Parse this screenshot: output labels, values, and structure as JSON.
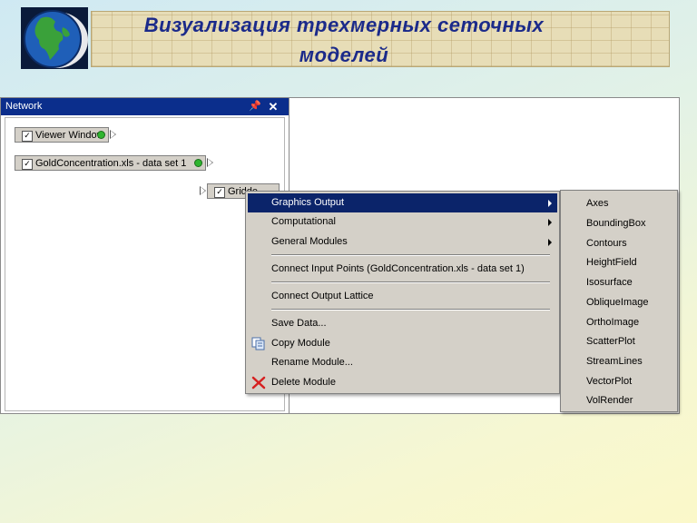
{
  "slide": {
    "title_line1": "Визуализация трехмерных сеточных",
    "title_line2": "моделей"
  },
  "colors": {
    "titlebar": "#0b2e8c",
    "menu_highlight": "#0b246a",
    "title_text": "#1b2a8a",
    "status_dot": "#2fb52f"
  },
  "network": {
    "title": "Network",
    "pin_icon": "pin-icon",
    "close_icon": "close-icon",
    "modules": [
      {
        "label": "Viewer Window",
        "checked": true
      },
      {
        "label": "GoldConcentration.xls - data set 1",
        "checked": true
      },
      {
        "label": "Gridde",
        "checked": true
      }
    ]
  },
  "context_menu": {
    "items": [
      {
        "label": "Graphics Output",
        "submenu": true,
        "highlighted": true
      },
      {
        "label": "Computational",
        "submenu": true
      },
      {
        "label": "General Modules",
        "submenu": true
      },
      {
        "label": "Connect Input Points (GoldConcentration.xls - data set 1)"
      },
      {
        "label": "Connect Output Lattice"
      },
      {
        "label": "Save Data..."
      },
      {
        "label": "Copy Module",
        "icon": "copy-icon"
      },
      {
        "label": "Rename Module..."
      },
      {
        "label": "Delete Module",
        "icon": "delete-x-icon"
      }
    ]
  },
  "graphics_output_submenu": {
    "items": [
      "Axes",
      "BoundingBox",
      "Contours",
      "HeightField",
      "Isosurface",
      "ObliqueImage",
      "OrthoImage",
      "ScatterPlot",
      "StreamLines",
      "VectorPlot",
      "VolRender"
    ]
  }
}
